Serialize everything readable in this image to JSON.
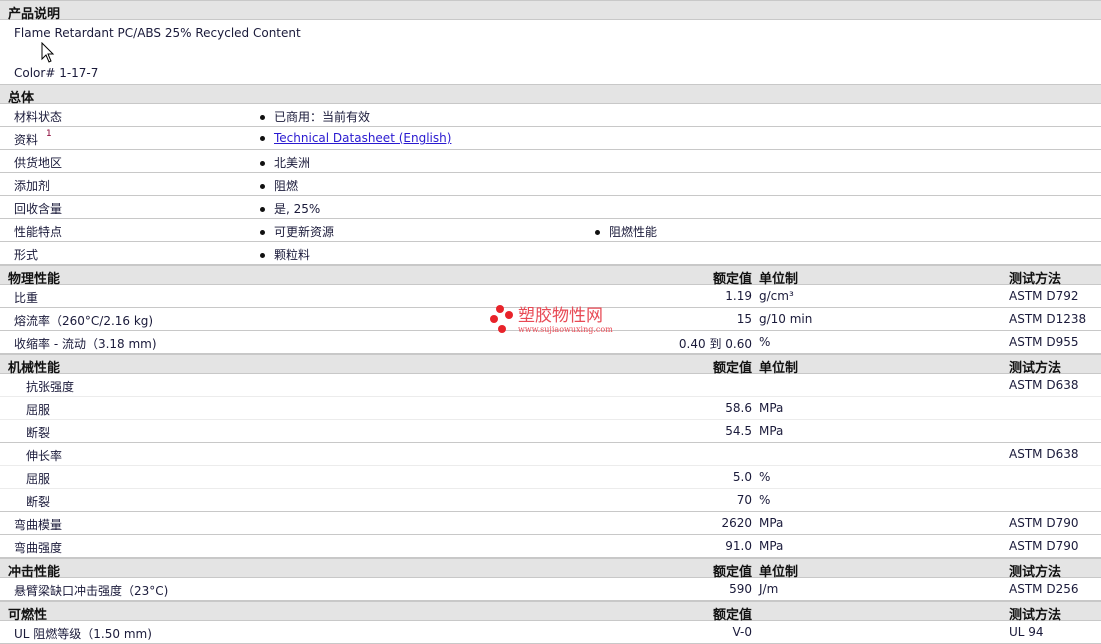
{
  "description": {
    "title": "产品说明",
    "line1": "Flame Retardant PC/ABS 25% Recycled Content",
    "line2": "Color# 1-17-7"
  },
  "general": {
    "title": "总体",
    "rows": [
      {
        "label": "材料状态",
        "items": [
          "已商用：当前有效"
        ]
      },
      {
        "label": "资料",
        "sup": "1",
        "items": [
          "Technical Datasheet (English)"
        ],
        "link": true
      },
      {
        "label": "供货地区",
        "items": [
          "北美洲"
        ]
      },
      {
        "label": "添加剂",
        "items": [
          "阻燃"
        ]
      },
      {
        "label": "回收含量",
        "items": [
          "是, 25%"
        ]
      },
      {
        "label": "性能特点",
        "items": [
          "可更新资源",
          "阻燃性能"
        ]
      },
      {
        "label": "形式",
        "items": [
          "颗粒料"
        ]
      }
    ]
  },
  "sections": [
    {
      "title": "物理性能",
      "h_value": "额定值",
      "h_unit": "单位制",
      "h_method": "测试方法",
      "rows": [
        {
          "label": "比重",
          "value": "1.19",
          "unit": "g/cm³",
          "method": "ASTM D792"
        },
        {
          "label": "熔流率（260°C/2.16 kg)",
          "value": "15",
          "unit": "g/10 min",
          "method": "ASTM D1238"
        },
        {
          "label": "收缩率 - 流动（3.18 mm)",
          "value": "0.40 到  0.60",
          "unit": "%",
          "method": "ASTM D955"
        }
      ]
    },
    {
      "title": "机械性能",
      "h_value": "额定值",
      "h_unit": "单位制",
      "h_method": "测试方法",
      "rows": [
        {
          "label": "抗张强度",
          "value": "",
          "unit": "",
          "method": "ASTM D638",
          "subnext": true
        },
        {
          "label": "屈服",
          "value": "58.6",
          "unit": "MPa",
          "method": "",
          "sub": true
        },
        {
          "label": "断裂",
          "value": "54.5",
          "unit": "MPa",
          "method": "",
          "sub": true,
          "last": true
        },
        {
          "label": "伸长率",
          "value": "",
          "unit": "",
          "method": "ASTM D638",
          "subnext": true
        },
        {
          "label": "屈服",
          "value": "5.0",
          "unit": "%",
          "method": "",
          "sub": true
        },
        {
          "label": "断裂",
          "value": "70",
          "unit": "%",
          "method": "",
          "sub": true,
          "last": true
        },
        {
          "label": "弯曲模量",
          "value": "2620",
          "unit": "MPa",
          "method": "ASTM D790"
        },
        {
          "label": "弯曲强度",
          "value": "91.0",
          "unit": "MPa",
          "method": "ASTM D790"
        }
      ]
    },
    {
      "title": "冲击性能",
      "h_value": "额定值",
      "h_unit": "单位制",
      "h_method": "测试方法",
      "rows": [
        {
          "label": "悬臂梁缺口冲击强度（23°C)",
          "value": "590",
          "unit": "J/m",
          "method": "ASTM D256"
        }
      ]
    },
    {
      "title": "可燃性",
      "h_value": "额定值",
      "h_unit": "",
      "h_method": "测试方法",
      "rows": [
        {
          "label": "UL 阻燃等级（1.50 mm)",
          "value": "V-0",
          "unit": "",
          "method": "UL 94"
        }
      ]
    }
  ],
  "watermark": {
    "name": "塑胶物性网",
    "url": "www.sujiaowuxing.com"
  }
}
